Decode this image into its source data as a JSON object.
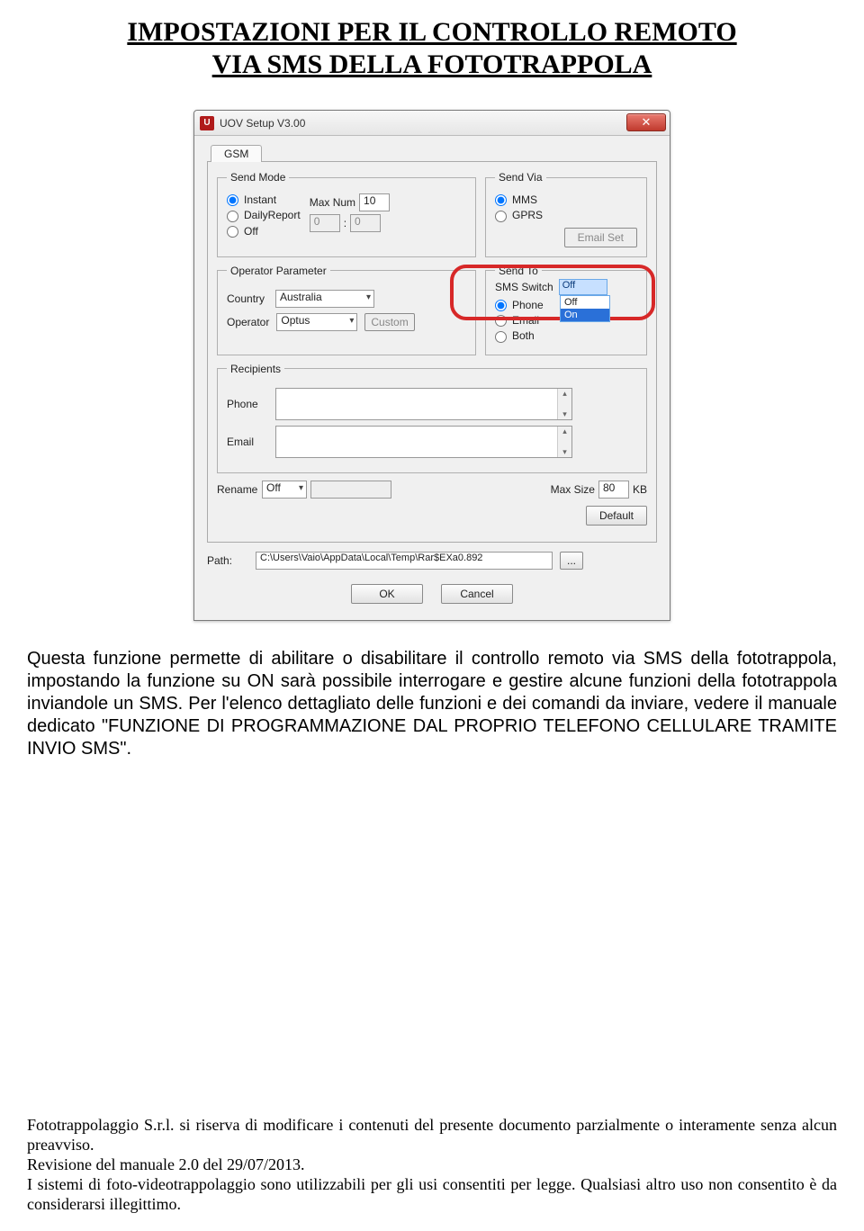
{
  "doc": {
    "title_line1": "IMPOSTAZIONI PER IL CONTROLLO REMOTO",
    "title_line2": "VIA SMS DELLA FOTOTRAPPOLA",
    "body_paragraph": "Questa funzione permette di abilitare o disabilitare il controllo remoto via SMS della fototrappola, impostando la funzione su ON sarà possibile interrogare e gestire alcune funzioni della fototrappola inviandole un SMS. Per l'elenco dettagliato delle funzioni e dei comandi da inviare, vedere il manuale dedicato \"FUNZIONE DI PROGRAMMAZIONE DAL PROPRIO TELEFONO CELLULARE TRAMITE INVIO SMS\".",
    "footer_p1": "Fototrappolaggio S.r.l. si riserva di modificare i contenuti del presente documento parzialmente o interamente senza alcun preavviso.",
    "footer_p2": "Revisione del manuale 2.0 del 29/07/2013.",
    "footer_p3": "I sistemi di foto-videotrappolaggio sono utilizzabili per gli usi consentiti per legge. Qualsiasi altro uso non consentito è da considerarsi illegittimo."
  },
  "win": {
    "title": "UOV Setup V3.00",
    "tab": "GSM",
    "send_mode": {
      "legend": "Send Mode",
      "instant": "Instant",
      "daily": "DailyReport",
      "off": "Off",
      "max_num_label": "Max Num",
      "max_num_value": "10",
      "daily_h": "0",
      "daily_m": "0"
    },
    "send_via": {
      "legend": "Send Via",
      "mms": "MMS",
      "gprs": "GPRS",
      "email_set": "Email Set"
    },
    "operator": {
      "legend": "Operator Parameter",
      "country_label": "Country",
      "country_value": "Australia",
      "operator_label": "Operator",
      "operator_value": "Optus",
      "custom": "Custom"
    },
    "sms_switch": {
      "label": "SMS Switch",
      "value": "Off",
      "opt_off": "Off",
      "opt_on": "On"
    },
    "send_to": {
      "legend": "Send To",
      "phone": "Phone",
      "email": "Email",
      "both": "Both"
    },
    "recipients": {
      "legend": "Recipients",
      "phone_label": "Phone",
      "email_label": "Email"
    },
    "rename": {
      "label": "Rename",
      "value": "Off"
    },
    "max_size": {
      "label": "Max Size",
      "value": "80",
      "unit": "KB"
    },
    "default_btn": "Default",
    "path_label": "Path:",
    "path_value": "C:\\Users\\Vaio\\AppData\\Local\\Temp\\Rar$EXa0.892",
    "path_browse": "...",
    "ok": "OK",
    "cancel": "Cancel"
  }
}
